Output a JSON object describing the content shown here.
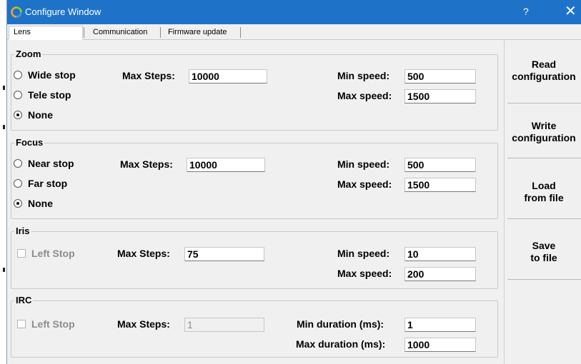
{
  "window": {
    "title": "Configure Window",
    "help_glyph": "?",
    "close_glyph": "✕",
    "accent": "#1e73c9"
  },
  "tabs": [
    {
      "label": "Lens",
      "active": true
    },
    {
      "label": "Communication",
      "active": false
    },
    {
      "label": "Firmware update",
      "active": false
    }
  ],
  "zoom": {
    "legend": "Zoom",
    "options": [
      "Wide stop",
      "Tele stop",
      "None"
    ],
    "selected": "None",
    "max_steps_label": "Max Steps:",
    "max_steps": "10000",
    "min_speed_label": "Min speed:",
    "min_speed": "500",
    "max_speed_label": "Max speed:",
    "max_speed": "1500"
  },
  "focus": {
    "legend": "Focus",
    "options": [
      "Near stop",
      "Far stop",
      "None"
    ],
    "selected": "None",
    "max_steps_label": "Max Steps:",
    "max_steps": "10000",
    "min_speed_label": "Min speed:",
    "min_speed": "500",
    "max_speed_label": "Max speed:",
    "max_speed": "1500"
  },
  "iris": {
    "legend": "Iris",
    "check_label": "Left Stop",
    "checked": false,
    "max_steps_label": "Max Steps:",
    "max_steps": "75",
    "min_speed_label": "Min speed:",
    "min_speed": "10",
    "max_speed_label": "Max speed:",
    "max_speed": "200"
  },
  "irc": {
    "legend": "IRC",
    "check_label": "Left Stop",
    "checked": false,
    "max_steps_label": "Max Steps:",
    "max_steps": "1",
    "min_duration_label": "Min duration (ms):",
    "min_duration": "1",
    "max_duration_label": "Max duration (ms):",
    "max_duration": "1000"
  },
  "side_buttons": {
    "read": [
      "Read",
      "configuration"
    ],
    "write": [
      "Write",
      "configuration"
    ],
    "load": [
      "Load",
      "from file"
    ],
    "save": [
      "Save",
      "to file"
    ]
  }
}
